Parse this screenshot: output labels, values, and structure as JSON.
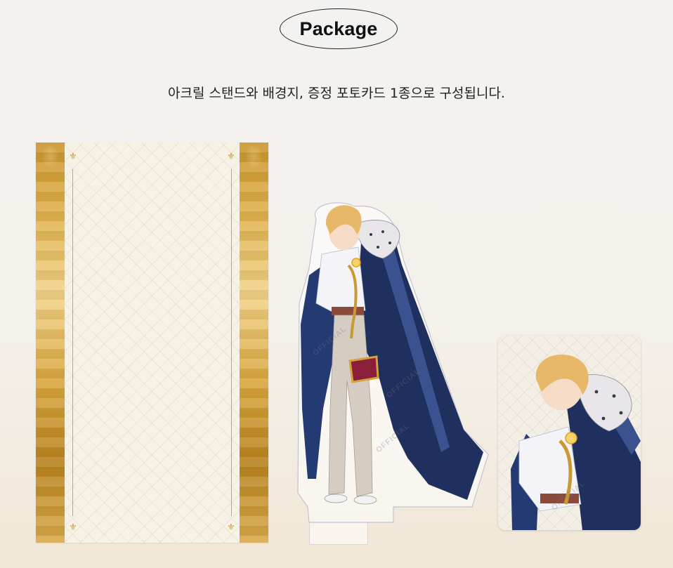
{
  "header": {
    "title": "Package",
    "subtitle": "아크릴 스탠드와 배경지, 증정 포토카드 1종으로 구성됩니다."
  },
  "watermark_text": "OFFICIAL",
  "items": [
    {
      "name": "background-paper"
    },
    {
      "name": "acrylic-stand"
    },
    {
      "name": "photocard"
    }
  ],
  "colors": {
    "gold": "#d9a63f",
    "cape_navy": "#1f2f5e",
    "hair": "#e8b86a",
    "paper": "#f7f2e6"
  }
}
